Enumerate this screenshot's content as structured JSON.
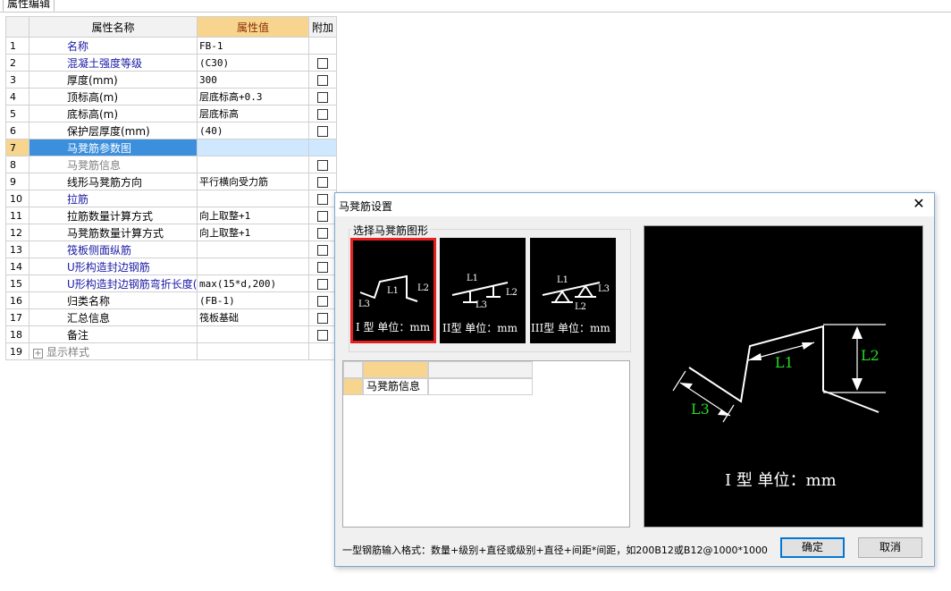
{
  "tab": {
    "label": "属性编辑"
  },
  "grid": {
    "headers": {
      "name": "属性名称",
      "value": "属性值",
      "extra": "附加"
    },
    "rows": [
      {
        "num": "1",
        "name": "名称",
        "value": "FB-1",
        "color": "blue",
        "check": false
      },
      {
        "num": "2",
        "name": "混凝土强度等级",
        "value": "(C30)",
        "color": "blue",
        "check": true
      },
      {
        "num": "3",
        "name": "厚度(mm)",
        "value": "300",
        "color": "black",
        "check": true
      },
      {
        "num": "4",
        "name": "顶标高(m)",
        "value": "层底标高+0.3",
        "color": "black",
        "check": true
      },
      {
        "num": "5",
        "name": "底标高(m)",
        "value": "层底标高",
        "color": "black",
        "check": true
      },
      {
        "num": "6",
        "name": "保护层厚度(mm)",
        "value": "(40)",
        "color": "black",
        "check": true
      },
      {
        "num": "7",
        "name": "马凳筋参数图",
        "value": "",
        "color": "sel",
        "check": false
      },
      {
        "num": "8",
        "name": "马凳筋信息",
        "value": "",
        "color": "gray",
        "check": true
      },
      {
        "num": "9",
        "name": "线形马凳筋方向",
        "value": "平行横向受力筋",
        "color": "black",
        "check": true
      },
      {
        "num": "10",
        "name": "拉筋",
        "value": "",
        "color": "blue",
        "check": true
      },
      {
        "num": "11",
        "name": "拉筋数量计算方式",
        "value": "向上取整+1",
        "color": "black",
        "check": true
      },
      {
        "num": "12",
        "name": "马凳筋数量计算方式",
        "value": "向上取整+1",
        "color": "black",
        "check": true
      },
      {
        "num": "13",
        "name": "筏板侧面纵筋",
        "value": "",
        "color": "blue",
        "check": true
      },
      {
        "num": "14",
        "name": "U形构造封边钢筋",
        "value": "",
        "color": "blue",
        "check": true
      },
      {
        "num": "15",
        "name": "U形构造封边钢筋弯折长度(mm)",
        "value": "max(15*d,200)",
        "color": "blue",
        "check": true
      },
      {
        "num": "16",
        "name": "归类名称",
        "value": "(FB-1)",
        "color": "black",
        "check": true
      },
      {
        "num": "17",
        "name": "汇总信息",
        "value": "筏板基础",
        "color": "black",
        "check": true
      },
      {
        "num": "18",
        "name": "备注",
        "value": "",
        "color": "black",
        "check": true
      },
      {
        "num": "19",
        "name": "显示样式",
        "value": "",
        "color": "gray",
        "check": false,
        "expand": "+"
      }
    ]
  },
  "dialog": {
    "title": "马凳筋设置",
    "close": "✕",
    "group_label": "选择马凳筋图形",
    "shapes": [
      {
        "caption": "I 型 单位：mm",
        "l1": "L1",
        "l2": "L2",
        "l3": "L3"
      },
      {
        "caption": "II型 单位：mm",
        "l1": "L1",
        "l2": "L2",
        "l3": "L3"
      },
      {
        "caption": "III型 单位：mm",
        "l1": "L1",
        "l2": "L2",
        "l3": "L3"
      }
    ],
    "sub_table": {
      "row_label": "马凳筋信息"
    },
    "preview": {
      "l1": "L1",
      "l2": "L2",
      "l3": "L3",
      "caption": "I 型  单位：mm"
    },
    "hint": "一型钢筋输入格式：数量+级别+直径或级别+直径+间距*间距，如200B12或B12@1000*1000",
    "ok": "确定",
    "cancel": "取消"
  }
}
